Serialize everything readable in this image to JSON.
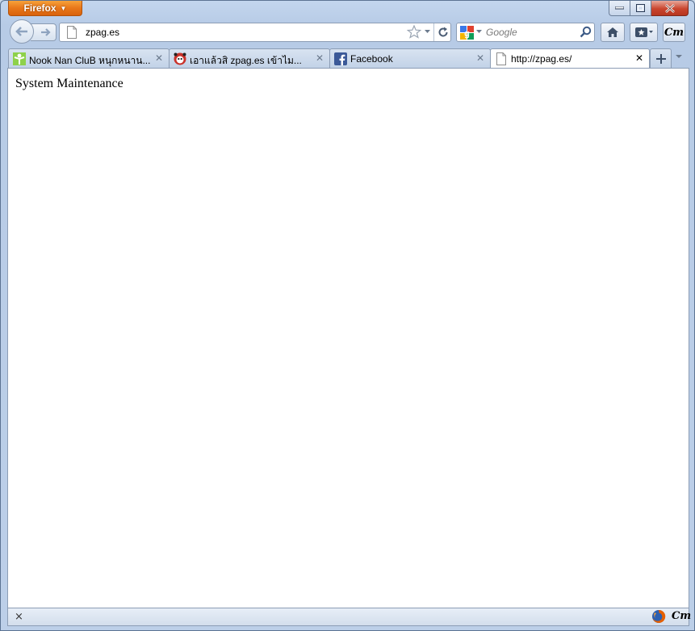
{
  "app_menu": {
    "label": "Firefox"
  },
  "nav": {
    "url": "zpag.es",
    "search_placeholder": "Google"
  },
  "toolbar": {
    "cm_label": "Cm"
  },
  "tabs": [
    {
      "title": "Nook Nan CluB หนุกหนาน...",
      "favicon": "green-figure-icon",
      "active": false
    },
    {
      "title": "เอาแล้วสิ zpag.es เข้าไม...",
      "favicon": "red-face-icon",
      "active": false
    },
    {
      "title": "Facebook",
      "favicon": "facebook-icon",
      "active": false
    },
    {
      "title": "http://zpag.es/",
      "favicon": "blank-page-icon",
      "active": true
    }
  ],
  "content": {
    "message": "System Maintenance"
  },
  "statusbar": {
    "close_label": "×",
    "cm_label": "Cm"
  }
}
